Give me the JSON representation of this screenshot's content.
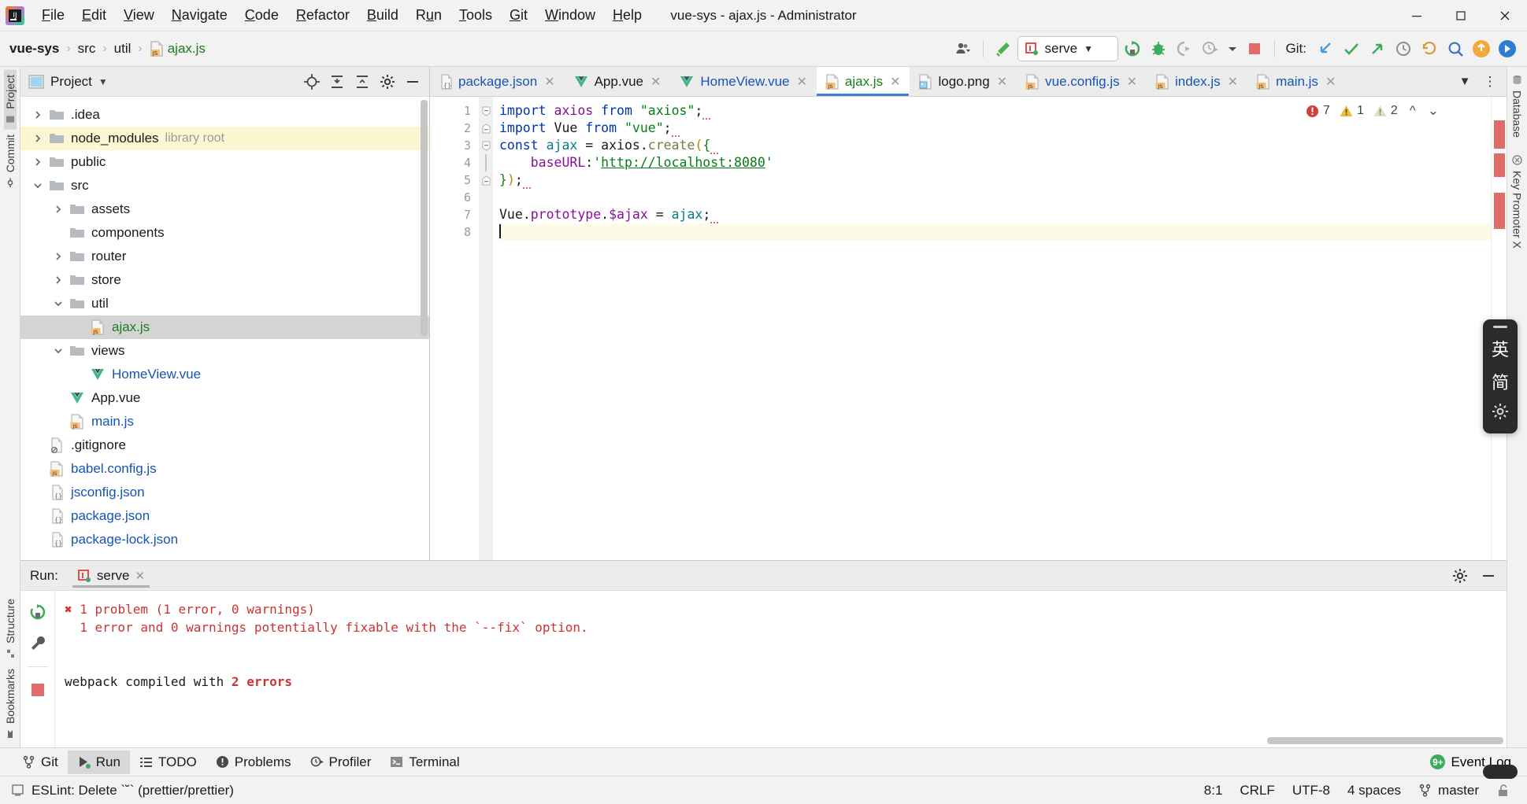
{
  "window": {
    "title": "vue-sys - ajax.js - Administrator",
    "minimize_label": "—",
    "maximize_label": "❐",
    "close_label": "✕"
  },
  "menu": {
    "items": [
      {
        "label": "File",
        "mnemonic": "F"
      },
      {
        "label": "Edit",
        "mnemonic": "E"
      },
      {
        "label": "View",
        "mnemonic": "V"
      },
      {
        "label": "Navigate",
        "mnemonic": "N"
      },
      {
        "label": "Code",
        "mnemonic": "C"
      },
      {
        "label": "Refactor",
        "mnemonic": "R"
      },
      {
        "label": "Build",
        "mnemonic": "B"
      },
      {
        "label": "Run",
        "mnemonic": "u"
      },
      {
        "label": "Tools",
        "mnemonic": "T"
      },
      {
        "label": "Git",
        "mnemonic": "G"
      },
      {
        "label": "Window",
        "mnemonic": "W"
      },
      {
        "label": "Help",
        "mnemonic": "H"
      }
    ]
  },
  "breadcrumb": {
    "items": [
      {
        "label": "vue-sys",
        "style": "bold"
      },
      {
        "label": "src",
        "style": "plain"
      },
      {
        "label": "util",
        "style": "plain"
      },
      {
        "label": "ajax.js",
        "style": "green",
        "icon": "js-file-icon"
      }
    ],
    "separator": "›"
  },
  "toolbar": {
    "run_config_name": "serve",
    "run_config_dropdown": "▼",
    "git_label": "Git:",
    "icons": [
      "user-accounts-icon",
      "build-hammer-icon",
      "run-icon",
      "debug-icon",
      "run-with-coverage-icon",
      "profiler-icon",
      "more-run-options-icon",
      "stop-icon",
      "update-project-icon",
      "commit-icon",
      "push-icon",
      "history-icon",
      "rollback-icon",
      "search-everywhere-icon",
      "notifications-icon",
      "ide-assistant-icon"
    ]
  },
  "left_strip": {
    "top": [
      {
        "label": "Project",
        "icon": "project-icon",
        "selected": true
      },
      {
        "label": "Commit",
        "icon": "commit-icon",
        "selected": false
      }
    ],
    "bottom": [
      {
        "label": "Structure",
        "icon": "structure-icon",
        "selected": false
      },
      {
        "label": "Bookmarks",
        "icon": "bookmarks-icon",
        "selected": false
      }
    ]
  },
  "right_strip": {
    "items": [
      {
        "label": "Database",
        "icon": "database-icon"
      },
      {
        "label": "Key Promoter X",
        "icon": "key-promoter-icon"
      }
    ]
  },
  "project_panel": {
    "title": "Project",
    "title_dropdown": "▼",
    "actions": [
      "locate-icon",
      "expand-all-icon",
      "collapse-all-icon",
      "settings-icon",
      "hide-icon"
    ],
    "tree": [
      {
        "label": "",
        "depth": 0,
        "twist": "",
        "icon": "",
        "kind": "spacer",
        "state": ""
      },
      {
        "label": ".idea",
        "depth": 1,
        "twist": "›",
        "icon": "folder-icon",
        "kind": "folder",
        "state": ""
      },
      {
        "label": "node_modules",
        "sublabel": "library root",
        "depth": 1,
        "twist": "›",
        "icon": "folder-icon",
        "kind": "folder",
        "state": "highlight"
      },
      {
        "label": "public",
        "depth": 1,
        "twist": "›",
        "icon": "folder-icon",
        "kind": "folder",
        "state": ""
      },
      {
        "label": "src",
        "depth": 1,
        "twist": "⌄",
        "icon": "folder-icon",
        "kind": "folder",
        "state": ""
      },
      {
        "label": "assets",
        "depth": 2,
        "twist": "›",
        "icon": "folder-icon",
        "kind": "folder",
        "state": ""
      },
      {
        "label": "components",
        "depth": 2,
        "twist": "",
        "icon": "folder-icon",
        "kind": "folder",
        "state": ""
      },
      {
        "label": "router",
        "depth": 2,
        "twist": "›",
        "icon": "folder-icon",
        "kind": "folder",
        "state": ""
      },
      {
        "label": "store",
        "depth": 2,
        "twist": "›",
        "icon": "folder-icon",
        "kind": "folder",
        "state": ""
      },
      {
        "label": "util",
        "depth": 2,
        "twist": "⌄",
        "icon": "folder-icon",
        "kind": "folder",
        "state": ""
      },
      {
        "label": "ajax.js",
        "depth": 3,
        "twist": "",
        "icon": "js-file-icon",
        "kind": "js-green",
        "state": "selected"
      },
      {
        "label": "views",
        "depth": 2,
        "twist": "⌄",
        "icon": "folder-icon",
        "kind": "folder",
        "state": ""
      },
      {
        "label": "HomeView.vue",
        "depth": 3,
        "twist": "",
        "icon": "vue-file-icon",
        "kind": "file",
        "state": ""
      },
      {
        "label": "App.vue",
        "depth": 2,
        "twist": "",
        "icon": "vue-file-icon",
        "kind": "file-dark",
        "state": ""
      },
      {
        "label": "main.js",
        "depth": 2,
        "twist": "",
        "icon": "js-file-icon",
        "kind": "file",
        "state": ""
      },
      {
        "label": ".gitignore",
        "depth": 1,
        "twist": "",
        "icon": "gitignore-file-icon",
        "kind": "file-dark",
        "state": ""
      },
      {
        "label": "babel.config.js",
        "depth": 1,
        "twist": "",
        "icon": "js-file-icon",
        "kind": "file",
        "state": ""
      },
      {
        "label": "jsconfig.json",
        "depth": 1,
        "twist": "",
        "icon": "json-file-icon",
        "kind": "file",
        "state": ""
      },
      {
        "label": "package.json",
        "depth": 1,
        "twist": "",
        "icon": "json-file-icon",
        "kind": "file",
        "state": ""
      },
      {
        "label": "package-lock.json",
        "depth": 1,
        "twist": "",
        "icon": "json-file-icon",
        "kind": "file",
        "state": ""
      }
    ]
  },
  "editor": {
    "tabs": [
      {
        "label": "package.json",
        "icon": "json-file-icon",
        "active": false,
        "color": "blue"
      },
      {
        "label": "App.vue",
        "icon": "vue-file-icon",
        "active": false,
        "color": "dark"
      },
      {
        "label": "HomeView.vue",
        "icon": "vue-file-icon",
        "active": false,
        "color": "blue"
      },
      {
        "label": "ajax.js",
        "icon": "js-file-icon",
        "active": true,
        "color": "green"
      },
      {
        "label": "logo.png",
        "icon": "image-file-icon",
        "active": false,
        "color": "dark"
      },
      {
        "label": "vue.config.js",
        "icon": "js-file-icon",
        "active": false,
        "color": "blue"
      },
      {
        "label": "index.js",
        "icon": "js-file-icon",
        "active": false,
        "color": "blue"
      },
      {
        "label": "main.js",
        "icon": "js-file-icon",
        "active": false,
        "color": "blue"
      }
    ],
    "tab_close": "✕",
    "tabs_overflow": "⌄",
    "tabs_more": "⋮",
    "line_numbers": [
      "1",
      "2",
      "3",
      "4",
      "5",
      "6",
      "7",
      "8"
    ],
    "inspections": {
      "error_count": "7",
      "warning_count": "1",
      "weak_warning_count": "2",
      "prev_label": "∧",
      "next_label": "∨"
    },
    "code_lines": [
      "import axios from \"axios\";",
      "import Vue from \"vue\";",
      "const ajax = axios.create({",
      "    baseURL:'http://localhost:8080'",
      "});",
      "",
      "Vue.prototype.$ajax = ajax;",
      ""
    ]
  },
  "run_panel": {
    "label": "Run:",
    "tab_name": "serve",
    "tab_close": "✕",
    "actions": [
      "settings-gear-icon",
      "hide-icon"
    ],
    "side_actions": [
      "rerun-icon",
      "wrench-icon",
      "stop-icon"
    ],
    "console": [
      {
        "text": "✖ 1 problem (1 error, 0 warnings)",
        "type": "error"
      },
      {
        "text": "  1 error and 0 warnings potentially fixable with the `--fix` option.",
        "type": "error"
      },
      {
        "text": "",
        "type": "blank"
      },
      {
        "text": "",
        "type": "blank"
      },
      {
        "text": "webpack compiled with 2 errors",
        "type": "error-mixed"
      }
    ]
  },
  "bottom_toolbar": {
    "items": [
      {
        "label": "Git",
        "icon": "git-branch-icon",
        "selected": false
      },
      {
        "label": "Run",
        "icon": "run-icon",
        "selected": true
      },
      {
        "label": "TODO",
        "icon": "todo-icon",
        "selected": false
      },
      {
        "label": "Problems",
        "icon": "problems-icon",
        "selected": false
      },
      {
        "label": "Profiler",
        "icon": "profiler-icon",
        "selected": false
      },
      {
        "label": "Terminal",
        "icon": "terminal-icon",
        "selected": false
      }
    ],
    "event_log_label": "Event Log",
    "event_log_badge": "9+"
  },
  "statusbar": {
    "message": "ESLint: Delete `˘` (prettier/prettier)",
    "message_icon": "inspection-icon",
    "caret_position": "8:1",
    "line_separator": "CRLF",
    "encoding": "UTF-8",
    "indent": "4 spaces",
    "branch": "master",
    "branch_icon": "git-branch-icon",
    "lock_icon": "unlocked-icon"
  },
  "ime": {
    "lang_label": "英",
    "mode_label": "简",
    "settings_label": "⚙"
  },
  "colors": {
    "accent_blue": "#3f7fd4",
    "error_red": "#cc3333",
    "warning_yellow": "#e8bf3d",
    "green": "#1a7d1a",
    "link_blue": "#1554b5",
    "keyword_blue": "#0033b3",
    "string_green": "#067d17",
    "class_purple": "#871094",
    "highlight_row": "#fdf6d3",
    "selected_row": "#d4d4d4"
  }
}
